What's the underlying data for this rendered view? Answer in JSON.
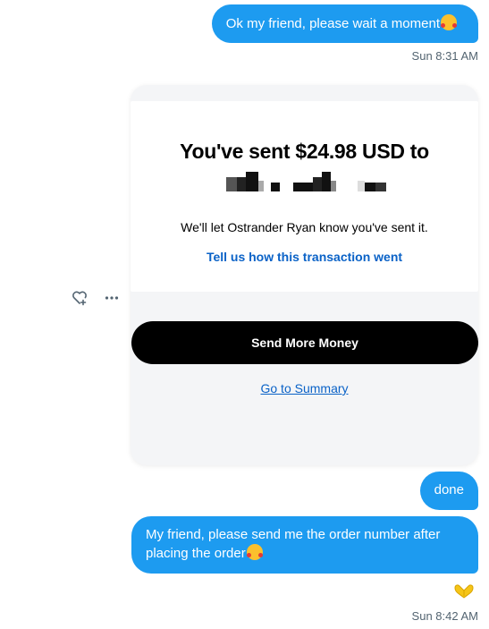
{
  "messages": [
    {
      "text": "Ok my friend, please wait a moment",
      "emoji": "smiling-face-with-hearts"
    },
    {
      "text": "done"
    },
    {
      "text": "My friend, please send me the order number after placing the order",
      "emoji": "smiling-face-with-hearts"
    }
  ],
  "timestamps": [
    "Sun 8:31 AM",
    "Sun 8:42 AM"
  ],
  "card": {
    "title": "You've sent $24.98 USD to",
    "recipient_redacted": true,
    "note": "We'll let Ostrander Ryan know you've sent it.",
    "feedback_link": "Tell us how this transaction went",
    "send_more_label": "Send More Money",
    "summary_link": "Go to Summary"
  },
  "actions": {
    "react_icon": "heart-plus-icon",
    "more_icon": "more-icon"
  },
  "reaction": {
    "icon": "heart-hands-icon",
    "color": "#f5c518"
  },
  "colors": {
    "bubble": "#1d9bf0",
    "link": "#0a62c7",
    "button": "#000000"
  }
}
